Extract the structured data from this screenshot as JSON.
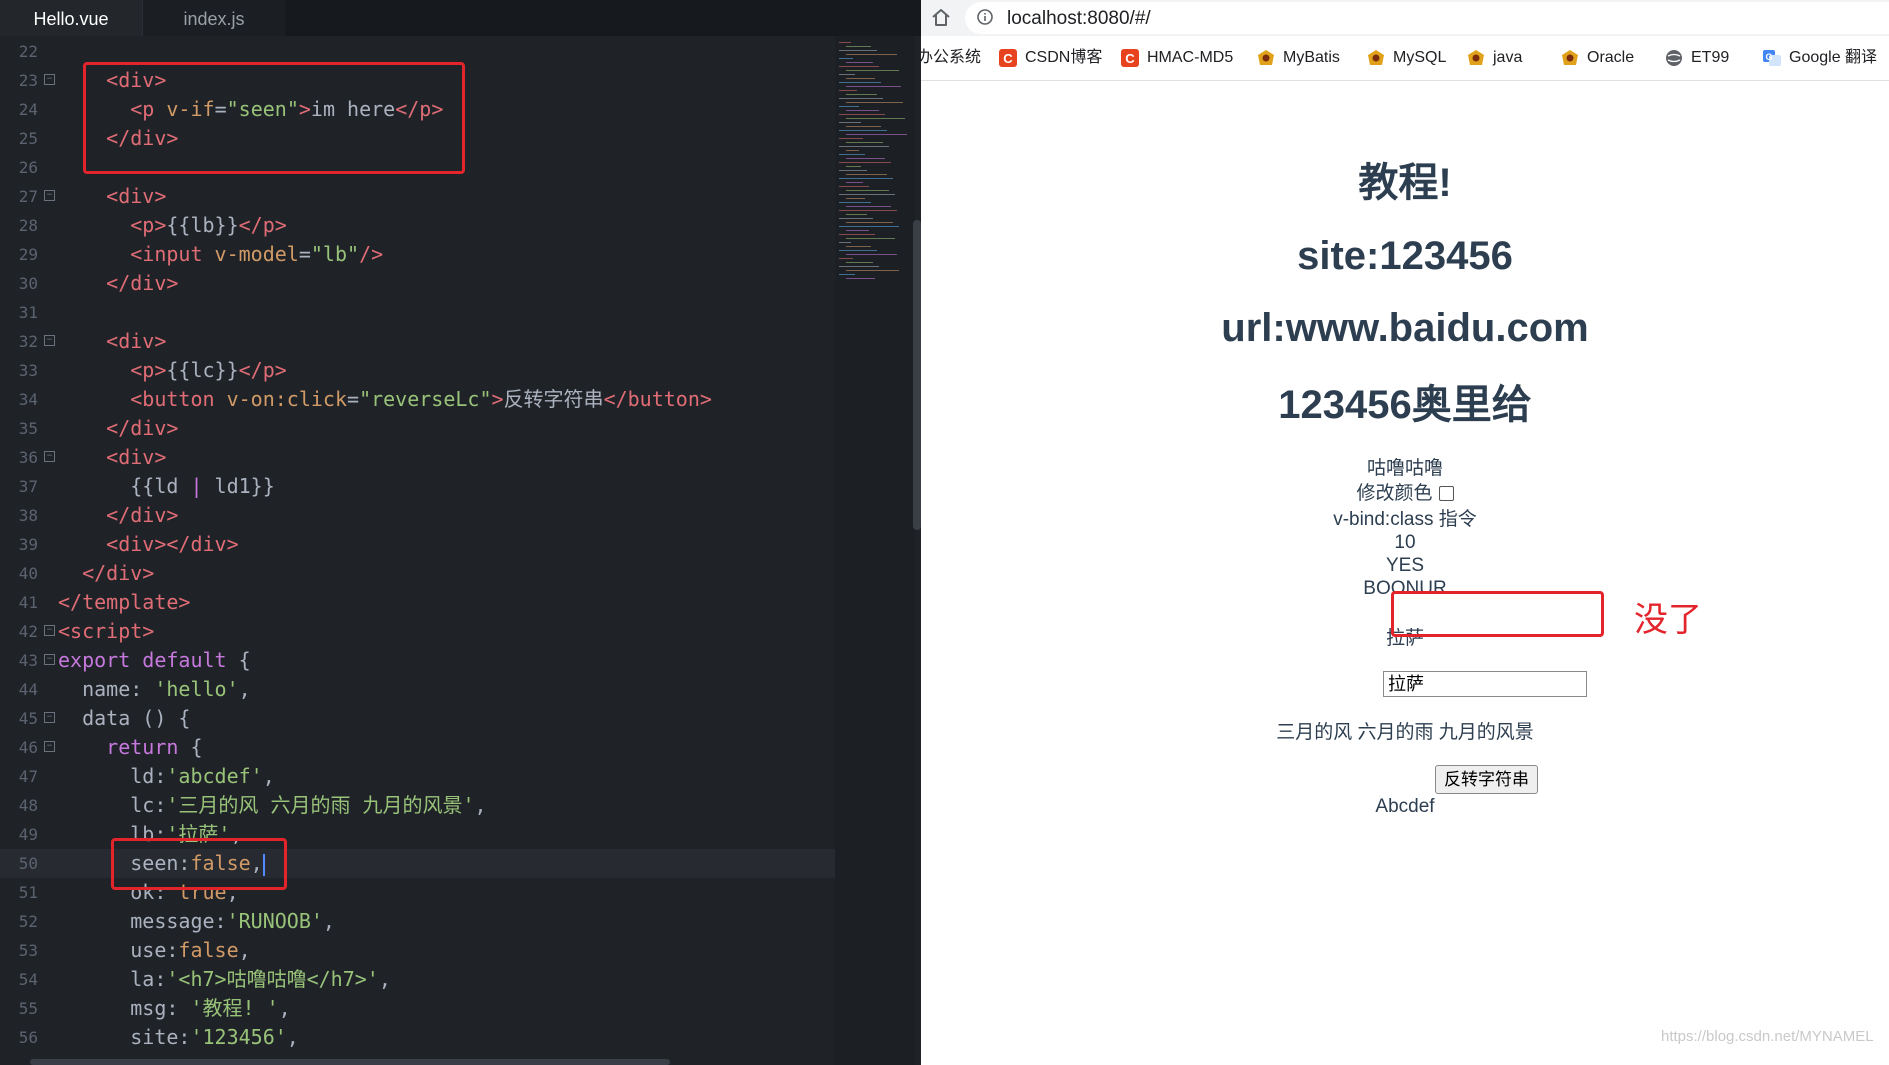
{
  "editor": {
    "tabs": [
      {
        "label": "Hello.vue",
        "active": true
      },
      {
        "label": "index.js",
        "active": false
      }
    ],
    "lines": [
      {
        "n": "22",
        "fold": false,
        "html": ""
      },
      {
        "n": "23",
        "fold": true,
        "html": "    <span class=\"t-tag\">&lt;div&gt;</span>"
      },
      {
        "n": "24",
        "fold": false,
        "html": "      <span class=\"t-tag\">&lt;p</span> <span class=\"t-attr\">v-if</span>=<span class=\"t-str\">\"seen\"</span><span class=\"t-tag\">&gt;</span>im here<span class=\"t-tag\">&lt;/p&gt;</span>"
      },
      {
        "n": "25",
        "fold": false,
        "html": "    <span class=\"t-tag\">&lt;/div&gt;</span>"
      },
      {
        "n": "26",
        "fold": false,
        "html": ""
      },
      {
        "n": "27",
        "fold": true,
        "html": "    <span class=\"t-tag\">&lt;div&gt;</span>"
      },
      {
        "n": "28",
        "fold": false,
        "html": "      <span class=\"t-tag\">&lt;p&gt;</span>{{lb}}<span class=\"t-tag\">&lt;/p&gt;</span>"
      },
      {
        "n": "29",
        "fold": false,
        "html": "      <span class=\"t-tag\">&lt;input</span> <span class=\"t-attr\">v-model</span>=<span class=\"t-str\">\"lb\"</span><span class=\"t-tag\">/&gt;</span>"
      },
      {
        "n": "30",
        "fold": false,
        "html": "    <span class=\"t-tag\">&lt;/div&gt;</span>"
      },
      {
        "n": "31",
        "fold": false,
        "html": ""
      },
      {
        "n": "32",
        "fold": true,
        "html": "    <span class=\"t-tag\">&lt;div&gt;</span>"
      },
      {
        "n": "33",
        "fold": false,
        "html": "      <span class=\"t-tag\">&lt;p&gt;</span>{{lc}}<span class=\"t-tag\">&lt;/p&gt;</span>"
      },
      {
        "n": "34",
        "fold": false,
        "html": "      <span class=\"t-tag\">&lt;button</span> <span class=\"t-attr\">v-on:click</span>=<span class=\"t-str\">\"reverseLc\"</span><span class=\"t-tag\">&gt;</span>反转字符串<span class=\"t-tag\">&lt;/button&gt;</span>"
      },
      {
        "n": "35",
        "fold": false,
        "html": "    <span class=\"t-tag\">&lt;/div&gt;</span>"
      },
      {
        "n": "36",
        "fold": true,
        "html": "    <span class=\"t-tag\">&lt;div&gt;</span>"
      },
      {
        "n": "37",
        "fold": false,
        "html": "      {{ld <span class=\"t-kw\">|</span> ld1}}"
      },
      {
        "n": "38",
        "fold": false,
        "html": "    <span class=\"t-tag\">&lt;/div&gt;</span>"
      },
      {
        "n": "39",
        "fold": false,
        "html": "    <span class=\"t-tag\">&lt;div&gt;&lt;/div&gt;</span>"
      },
      {
        "n": "40",
        "fold": false,
        "html": "  <span class=\"t-tag\">&lt;/div&gt;</span>"
      },
      {
        "n": "41",
        "fold": false,
        "html": "<span class=\"t-tag\">&lt;/template&gt;</span>"
      },
      {
        "n": "42",
        "fold": true,
        "html": "<span class=\"t-tag\">&lt;script&gt;</span>"
      },
      {
        "n": "43",
        "fold": true,
        "html": "<span class=\"t-kw\">export default</span> {"
      },
      {
        "n": "44",
        "fold": false,
        "html": "  name: <span class=\"t-str\">'hello'</span>,"
      },
      {
        "n": "45",
        "fold": true,
        "html": "  data () {"
      },
      {
        "n": "46",
        "fold": true,
        "html": "    <span class=\"t-kw\">return</span> {"
      },
      {
        "n": "47",
        "fold": false,
        "html": "      ld:<span class=\"t-str\">'abcdef'</span>,"
      },
      {
        "n": "48",
        "fold": false,
        "html": "      lc:<span class=\"t-str\">'三月的风 六月的雨 九月的风景'</span>,"
      },
      {
        "n": "49",
        "fold": false,
        "html": "      lb:<span class=\"t-str\">'拉萨'</span>,"
      },
      {
        "n": "50",
        "fold": false,
        "current": true,
        "html": "      seen:<span class=\"t-bool\">false</span>,<span class=\"caret\"></span>"
      },
      {
        "n": "51",
        "fold": false,
        "html": "      ok: <span class=\"t-bool\">true</span>,"
      },
      {
        "n": "52",
        "fold": false,
        "html": "      message:<span class=\"t-str\">'RUNOOB'</span>,"
      },
      {
        "n": "53",
        "fold": false,
        "html": "      use:<span class=\"t-bool\">false</span>,"
      },
      {
        "n": "54",
        "fold": false,
        "html": "      la:<span class=\"t-str\">'&lt;h7&gt;咕噜咕噜&lt;/h7&gt;'</span>,"
      },
      {
        "n": "55",
        "fold": false,
        "html": "      msg: <span class=\"t-str\">'教程! '</span>,"
      },
      {
        "n": "56",
        "fold": false,
        "html": "      site:<span class=\"t-str\">'123456'</span>,"
      }
    ]
  },
  "browser": {
    "url": "localhost:8080/#/",
    "bookmarks": [
      {
        "label": "办公系统",
        "icon": "none",
        "color": ""
      },
      {
        "label": "CSDN博客",
        "icon": "csdn-icon",
        "color": "#e8431f"
      },
      {
        "label": "HMAC-MD5",
        "icon": "csdn-icon",
        "color": "#e8431f"
      },
      {
        "label": "MyBatis",
        "icon": "leaf-icon",
        "color": "#e0a21a"
      },
      {
        "label": "MySQL",
        "icon": "leaf-icon",
        "color": "#e0a21a"
      },
      {
        "label": "java",
        "icon": "leaf-icon",
        "color": "#e0a21a"
      },
      {
        "label": "Oracle",
        "icon": "leaf-icon",
        "color": "#e0a21a"
      },
      {
        "label": "ET99",
        "icon": "globe-icon",
        "color": "#5f6368"
      },
      {
        "label": "Google 翻译",
        "icon": "translate-icon",
        "color": "#4285f4"
      },
      {
        "label": "",
        "icon": "vue-icon",
        "color": "#41b883"
      }
    ],
    "page": {
      "h_msg": "教程!",
      "h_site": "site:123456",
      "h_url": "url:www.baidu.com",
      "h_combo": "123456奥里给",
      "gulu": "咕噜咕噜",
      "modify_color": "修改颜色",
      "vbind": "v-bind:class 指令",
      "num": "10",
      "yes": "YES",
      "boonur": "BOONUR",
      "lasa": "拉萨",
      "input_value": "拉萨",
      "lc_text": "三月的风 六月的雨 九月的风景",
      "reverse_btn": "反转字符串",
      "filtered": "Abcdef"
    },
    "annotation": "没了",
    "watermark": "https://blog.csdn.net/MYNAMEL"
  },
  "colors": {
    "editor_bg": "#1f2328",
    "annotation_red": "#e3242b",
    "page_text": "#2c3e50"
  }
}
